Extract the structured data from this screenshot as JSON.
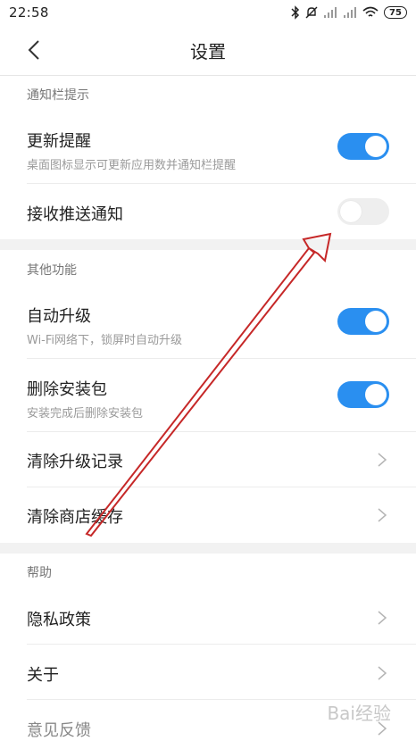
{
  "status": {
    "time": "22:58",
    "battery": "75"
  },
  "nav": {
    "title": "设置"
  },
  "sections": {
    "notification": {
      "header": "通知栏提示",
      "update_reminder": {
        "title": "更新提醒",
        "subtitle": "桌面图标显示可更新应用数并通知栏提醒",
        "enabled": true
      },
      "push": {
        "title": "接收推送通知",
        "enabled": false
      }
    },
    "other": {
      "header": "其他功能",
      "auto_upgrade": {
        "title": "自动升级",
        "subtitle": "Wi-Fi网络下，锁屏时自动升级",
        "enabled": true
      },
      "delete_package": {
        "title": "删除安装包",
        "subtitle": "安装完成后删除安装包",
        "enabled": true
      },
      "clear_history": {
        "title": "清除升级记录"
      },
      "clear_cache": {
        "title": "清除商店缓存"
      }
    },
    "help": {
      "header": "帮助",
      "privacy": {
        "title": "隐私政策"
      },
      "about": {
        "title": "关于"
      },
      "feedback": {
        "title": "意见反馈"
      }
    }
  },
  "watermark": "Bai经验",
  "colors": {
    "toggle_on": "#2a8ff0",
    "toggle_off": "#eeeeee",
    "annotation_arrow": "#c62828"
  }
}
